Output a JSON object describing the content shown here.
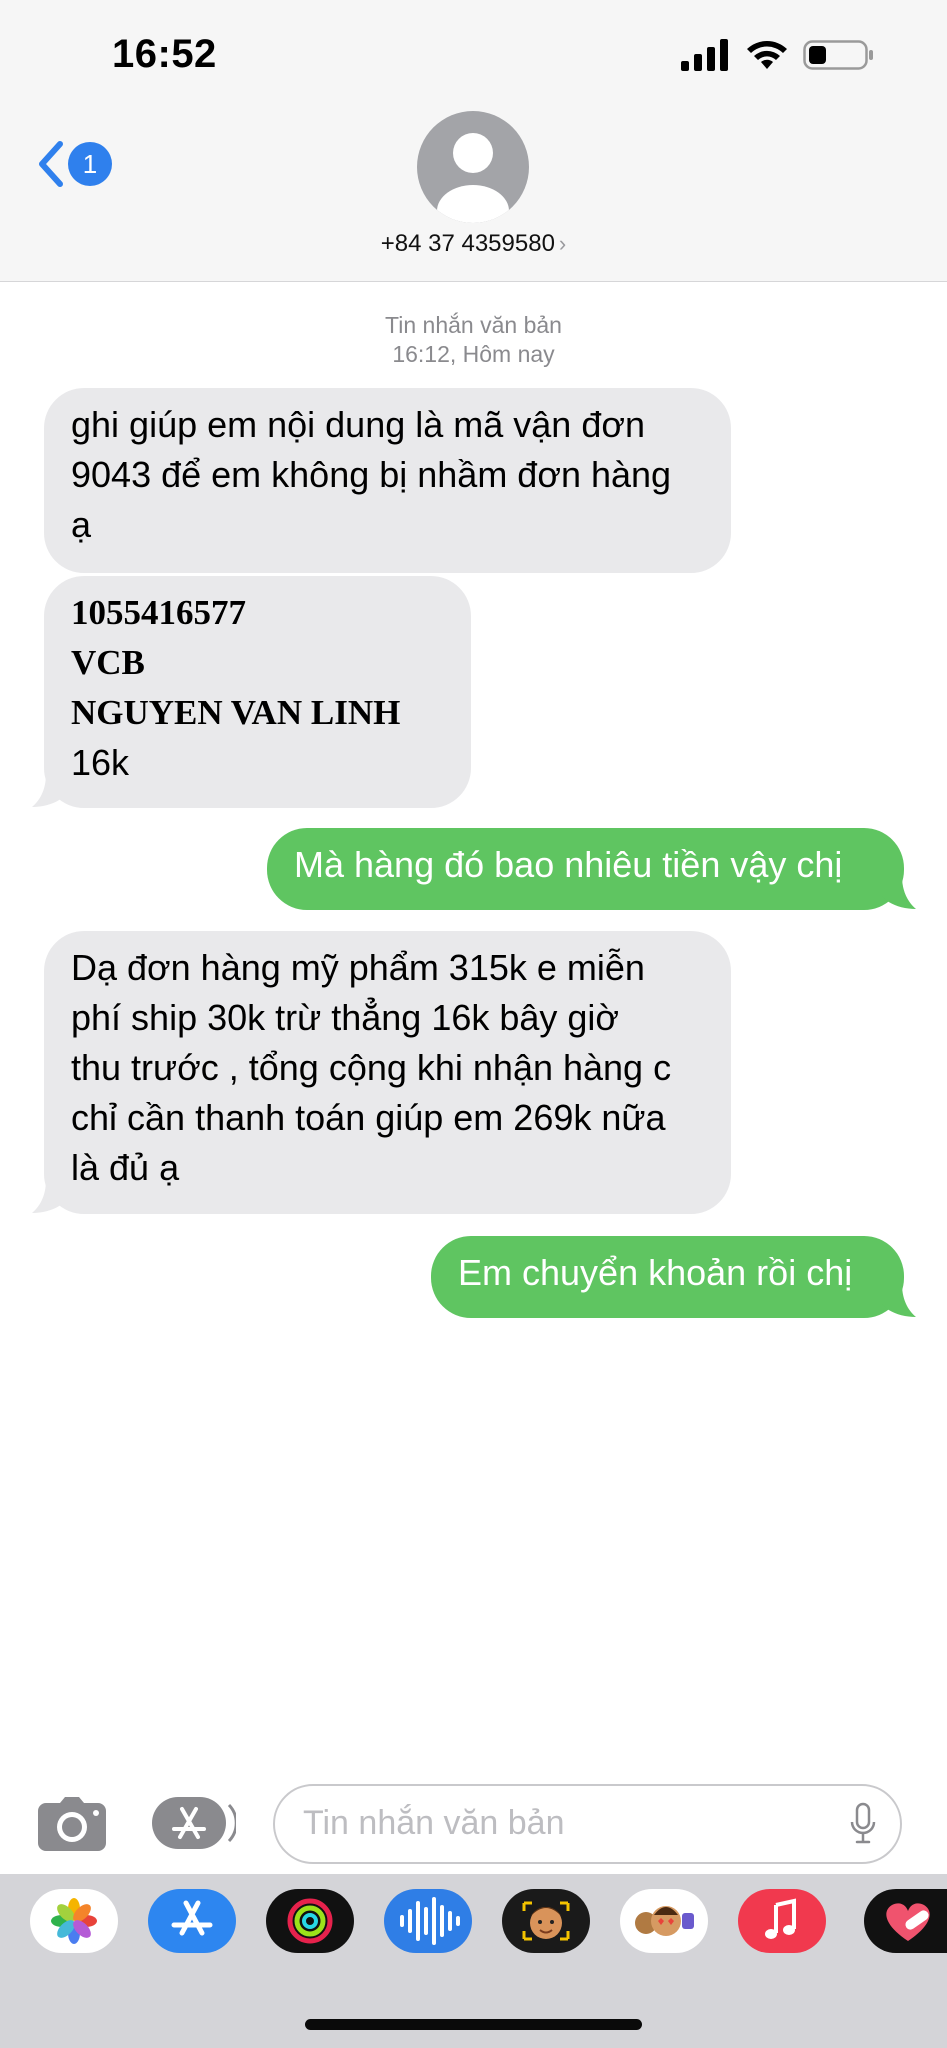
{
  "status_bar": {
    "time": "16:52"
  },
  "header": {
    "back_badge": "1",
    "contact": "+84 37 4359580",
    "contact_chevron": "›"
  },
  "conversation": {
    "type_label": "Tin nhắn văn bản",
    "timestamp": "16:12, Hôm nay",
    "messages": [
      {
        "direction": "incoming",
        "lines": [
          "ghi giúp em nội dung là mã vận đơn",
          "9043 để em không bị nhầm đơn hàng",
          "ạ"
        ]
      },
      {
        "direction": "incoming",
        "lines": [
          "1055416577",
          "VCB",
          "NGUYEN VAN LINH",
          "16k"
        ]
      },
      {
        "direction": "outgoing",
        "lines": [
          "Mà hàng đó bao nhiêu tiền vậy chị"
        ]
      },
      {
        "direction": "incoming",
        "lines": [
          "Dạ đơn hàng mỹ phẩm 315k e miễn",
          "phí ship 30k trừ thẳng 16k bây giờ",
          "thu trước , tổng cộng khi nhận hàng c",
          "chỉ cần thanh toán giúp em 269k nữa",
          "là đủ ạ"
        ]
      },
      {
        "direction": "outgoing",
        "lines": [
          "Em chuyển khoản rồi chị"
        ]
      }
    ]
  },
  "composer": {
    "placeholder": "Tin nhắn văn bản"
  },
  "colors": {
    "incoming": "#e9e9eb",
    "outgoing": "#5fc561",
    "accent": "#2f80ed"
  },
  "icons": [
    "cellular-signal-icon",
    "wifi-icon",
    "battery-icon",
    "back-chevron-icon",
    "contact-avatar-icon",
    "camera-icon",
    "app-store-icon",
    "microphone-icon",
    "photos-app-icon",
    "app-store-app-icon",
    "activity-app-icon",
    "audio-message-app-icon",
    "memoji-app-icon",
    "memoji-stickers-app-icon",
    "music-app-icon",
    "heart-app-icon"
  ]
}
